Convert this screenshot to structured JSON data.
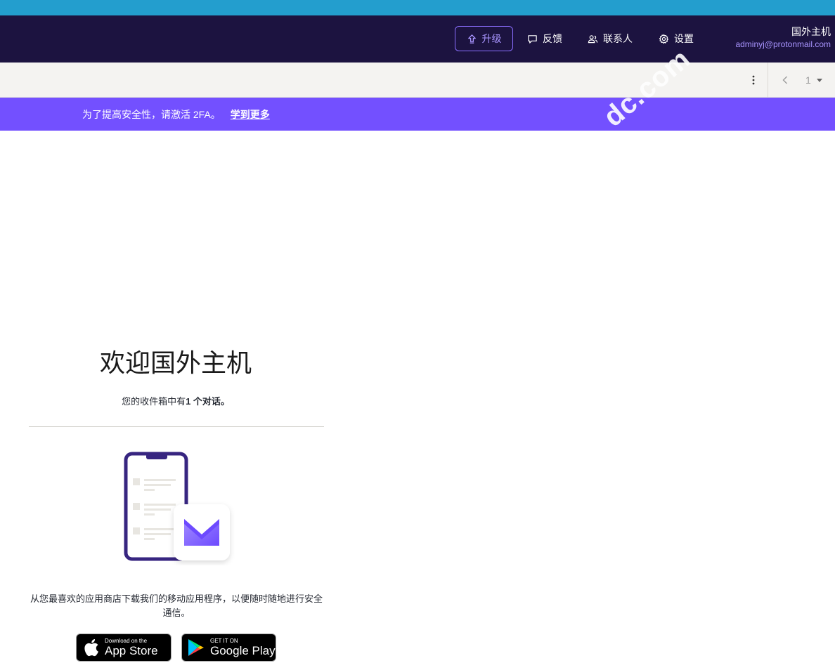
{
  "header": {
    "upgrade_label": "升级",
    "feedback_label": "反馈",
    "contacts_label": "联系人",
    "settings_label": "设置",
    "user_name": "国外主机",
    "user_email": "adminyj@protonmail.com"
  },
  "toolbar": {
    "page_number": "1"
  },
  "banner": {
    "message": "为了提高安全性，请激活 2FA。",
    "link_label": "学到更多"
  },
  "watermark": {
    "text": "dc.com"
  },
  "welcome": {
    "title": "欢迎国外主机",
    "subtitle_prefix": "您的收件箱中有",
    "subtitle_bold": "1 个对话",
    "subtitle_suffix": "。"
  },
  "download": {
    "text": "从您最喜欢的应用商店下载我们的移动应用程序，以便随时随地进行安全通信。",
    "appstore_small": "Download on the",
    "appstore_big": "App Store",
    "gplay_small": "GET IT ON",
    "gplay_big": "Google Play"
  },
  "colors": {
    "top_strip": "#239ece",
    "header_bg": "#1c1340",
    "accent": "#7350ff",
    "toolbar_bg": "#f4f3f1"
  },
  "icons": {
    "upgrade": "upgrade-arrow-icon",
    "feedback": "speech-bubble-icon",
    "contacts": "users-icon",
    "settings": "gear-icon",
    "more": "kebab-icon",
    "prev": "chevron-left-icon",
    "page_dropdown": "caret-down-icon"
  }
}
